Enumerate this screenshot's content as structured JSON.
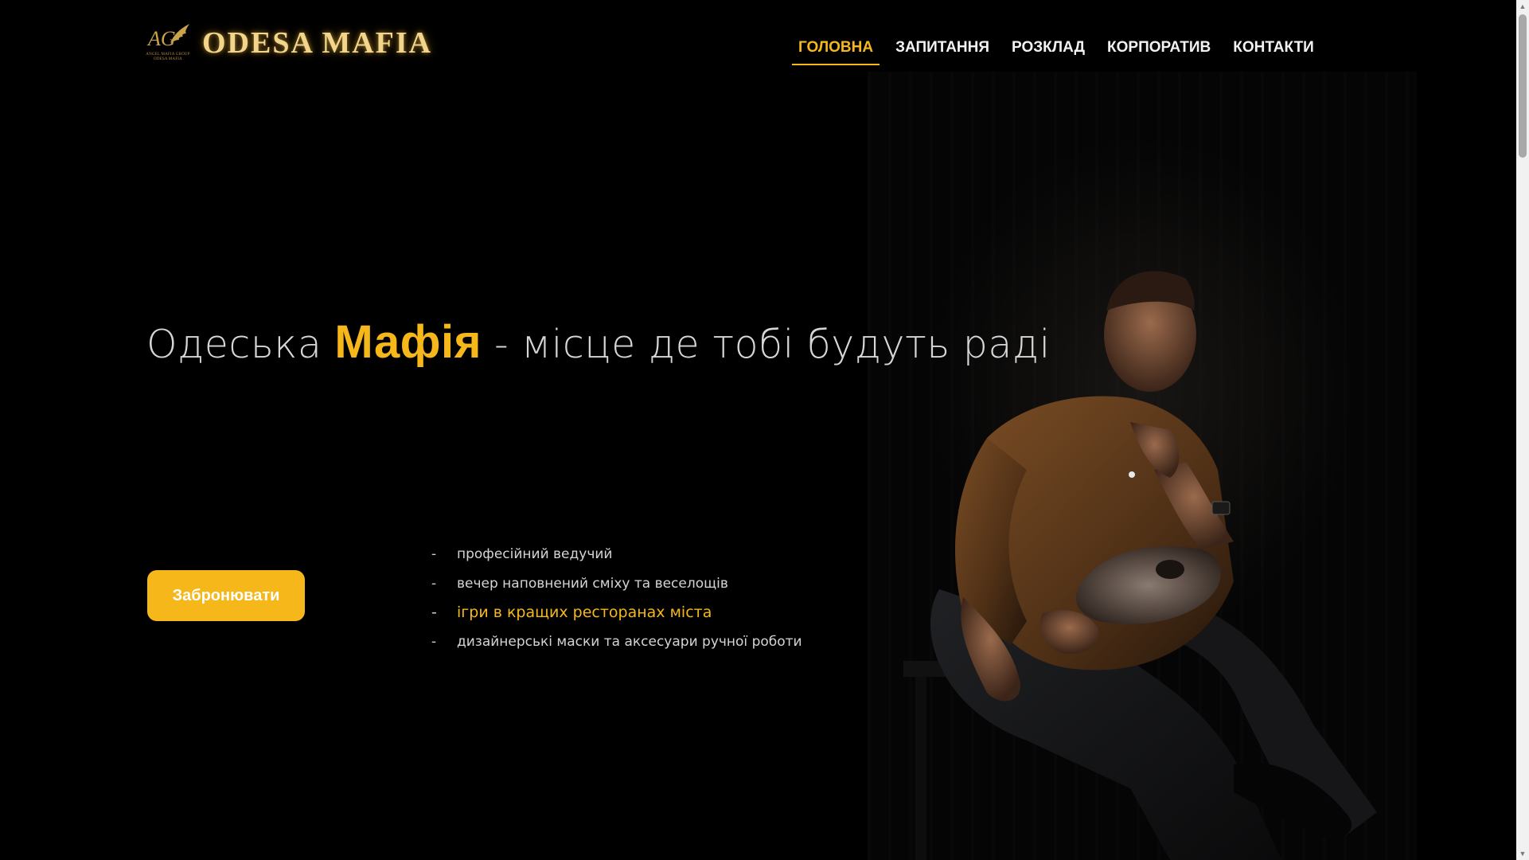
{
  "brand": {
    "name": "ODESA MAFIA",
    "emblem_monogram": "AG",
    "emblem_subtitle": "ANGEL MAFIA GROUP ODESA MAFIA",
    "gold": "#f6b71b"
  },
  "nav": {
    "items": [
      {
        "label": "ГОЛОВНА",
        "active": true
      },
      {
        "label": "ЗАПИТАННЯ",
        "active": false
      },
      {
        "label": "РОЗКЛАД",
        "active": false
      },
      {
        "label": "КОРПОРАТИВ",
        "active": false
      },
      {
        "label": "КОНТАКТИ",
        "active": false
      }
    ]
  },
  "hero": {
    "headline_prefix": "Одеська ",
    "headline_accent": "Мафія",
    "headline_suffix": " - місце де тобі будуть раді",
    "cta_label": "Забронювати",
    "features": [
      {
        "dash": "-",
        "text": "професійний ведучий",
        "highlight": false
      },
      {
        "dash": "-",
        "text": "вечер наповнений сміху та веселощів",
        "highlight": false
      },
      {
        "dash": "-",
        "text": "ігри в кращих ресторанах міста",
        "highlight": true
      },
      {
        "dash": "-",
        "text": "дизайнерські маски та аксесуари ручної роботи",
        "highlight": false
      }
    ]
  },
  "icons": {
    "wing": "wing-icon",
    "scroll_up": "chevron-up-icon",
    "scroll_down": "chevron-down-icon"
  }
}
